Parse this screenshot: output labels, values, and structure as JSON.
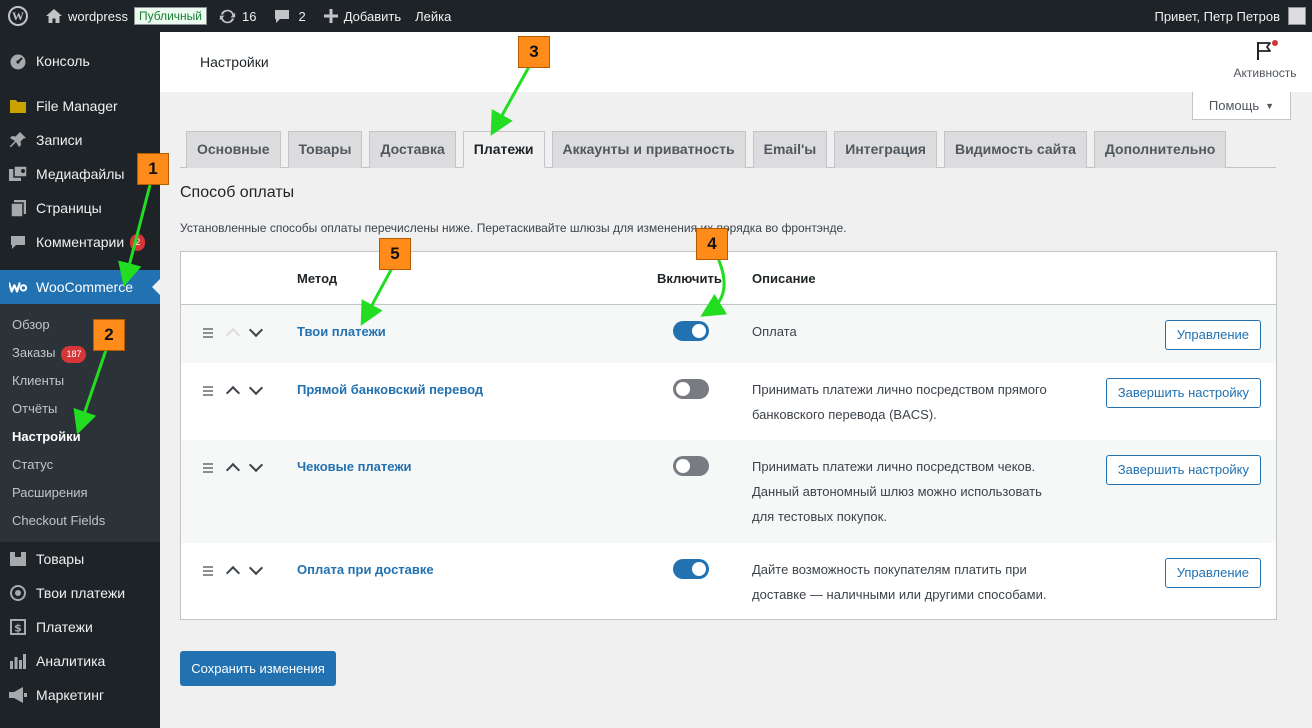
{
  "admin_bar": {
    "site_name": "wordpress",
    "public_badge": "Публичный",
    "updates_count": "16",
    "comments_count": "2",
    "add_label": "Добавить",
    "plugin_label": "Лейка",
    "greeting": "Привет, Петр Петров"
  },
  "sidebar": {
    "items_top": [
      {
        "label": "Консоль",
        "icon": "dashboard-icon"
      },
      {
        "label": "File Manager",
        "icon": "folder-icon"
      },
      {
        "label": "Записи",
        "icon": "pin-icon"
      },
      {
        "label": "Медиафайлы",
        "icon": "media-icon"
      },
      {
        "label": "Страницы",
        "icon": "pages-icon"
      },
      {
        "label": "Комментарии",
        "icon": "comments-icon",
        "badge": "2"
      },
      {
        "label": "WooCommerce",
        "icon": "woo-icon"
      }
    ],
    "submenu": [
      {
        "label": "Обзор"
      },
      {
        "label": "Заказы",
        "badge": "187"
      },
      {
        "label": "Клиенты"
      },
      {
        "label": "Отчёты"
      },
      {
        "label": "Настройки"
      },
      {
        "label": "Статус"
      },
      {
        "label": "Расширения"
      },
      {
        "label": "Checkout Fields"
      }
    ],
    "items_bottom": [
      {
        "label": "Товары",
        "icon": "products-icon"
      },
      {
        "label": "Твои платежи",
        "icon": "payments-circle-icon"
      },
      {
        "label": "Платежи",
        "icon": "dollar-icon"
      },
      {
        "label": "Аналитика",
        "icon": "chart-icon"
      },
      {
        "label": "Маркетинг",
        "icon": "megaphone-icon"
      }
    ]
  },
  "header": {
    "title": "Настройки",
    "activity_label": "Активность",
    "help_label": "Помощь"
  },
  "tabs": [
    "Основные",
    "Товары",
    "Доставка",
    "Платежи",
    "Аккаунты и приватность",
    "Email'ы",
    "Интеграция",
    "Видимость сайта",
    "Дополнительно"
  ],
  "active_tab": "Платежи",
  "section": {
    "title": "Способ оплаты",
    "description": "Установленные способы оплаты перечислены ниже. Перетаскивайте шлюзы для изменения их порядка во фронтэнде."
  },
  "table": {
    "headers": {
      "method": "Метод",
      "enable": "Включить",
      "description": "Описание"
    },
    "rows": [
      {
        "name": "Твои платежи",
        "enabled": true,
        "desc_lines": [
          "Оплата"
        ],
        "button": "Управление"
      },
      {
        "name": "Прямой банковский перевод",
        "enabled": false,
        "desc_lines": [
          "Принимать платежи лично посредством прямого",
          "банковского перевода (BACS)."
        ],
        "button": "Завершить настройку"
      },
      {
        "name": "Чековые платежи",
        "enabled": false,
        "desc_lines": [
          "Принимать платежи лично посредством чеков.",
          "Данный автономный шлюз можно использовать",
          "для тестовых покупок."
        ],
        "button": "Завершить настройку"
      },
      {
        "name": "Оплата при доставке",
        "enabled": true,
        "desc_lines": [
          "Дайте возможность покупателям платить при",
          "доставке — наличными или другими способами."
        ],
        "button": "Управление"
      }
    ]
  },
  "save_label": "Сохранить изменения",
  "annotations": [
    "1",
    "2",
    "3",
    "4",
    "5"
  ],
  "colors": {
    "accent": "#2271b1",
    "admin_dark": "#1d2327",
    "annotation": "#ff8c1a",
    "arrow": "#22dd22",
    "badge_red": "#d63638"
  }
}
